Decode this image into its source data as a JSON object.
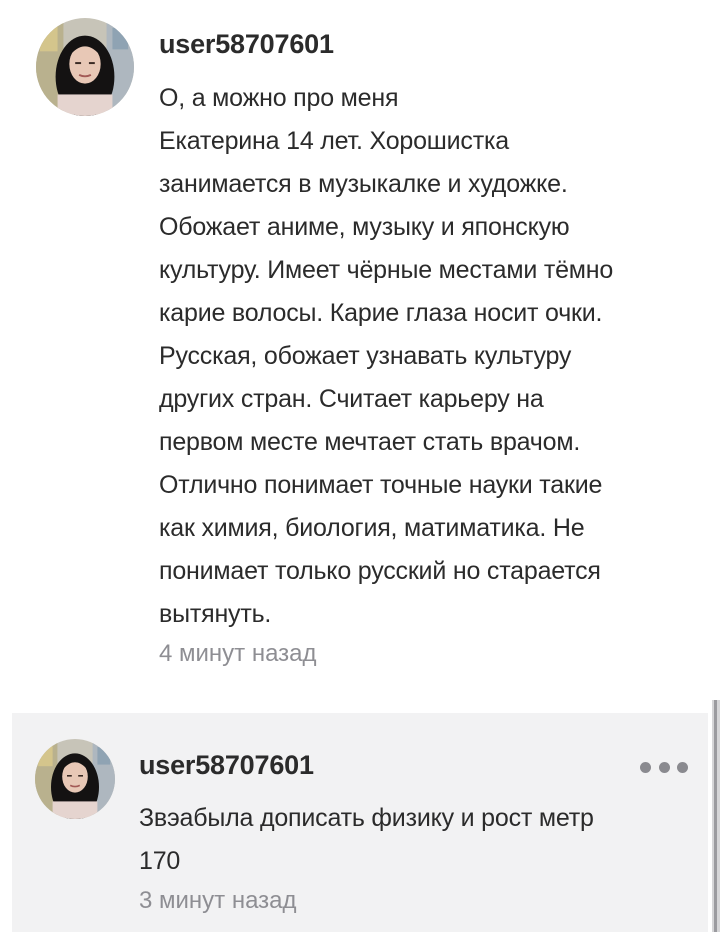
{
  "comments": [
    {
      "username": "user58707601",
      "text": "О, а можно про меня\nЕкатерина 14 лет. Хорошистка\nзанимается в музыкалке и художке.\nОбожает аниме, музыку и японскую\nкультуру. Имеет чёрные местами тёмно\nкарие волосы. Карие глаза носит очки.\nРусская, обожает узнавать культуру\nдругих стран. Считает карьеру на\nпервом месте мечтает стать врачом.\nОтлично понимает точные науки такие\nкак химия, биология, матиматика. Не\nпонимает только русский но старается\nвытянуть.",
      "timestamp": "4 минут назад",
      "avatar_icon": "user-avatar-photo"
    },
    {
      "username": "user58707601",
      "text": "Звэабыла дописать физику и рост метр\n170",
      "timestamp": "3 минут назад",
      "avatar_icon": "user-avatar-photo",
      "more_icon": "more-options-icon"
    }
  ],
  "colors": {
    "text": "#2b2b2b",
    "timestamp": "#8e8e93",
    "reply_background": "#f2f2f3",
    "more_dots": "#8a8a8f"
  }
}
